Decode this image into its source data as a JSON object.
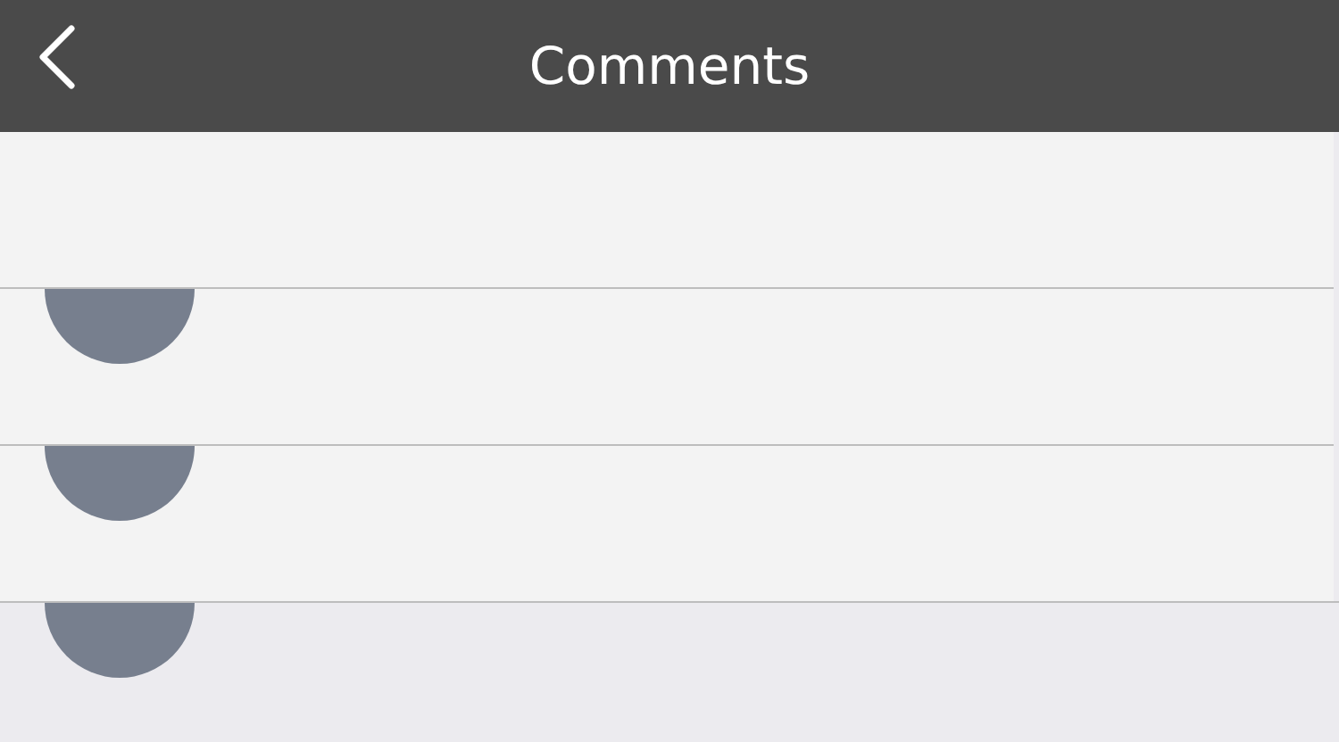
{
  "header": {
    "title": "Comments"
  },
  "comments": [
    {
      "kind": "avatar"
    },
    {
      "kind": "avatar"
    },
    {
      "kind": "avatar"
    }
  ]
}
